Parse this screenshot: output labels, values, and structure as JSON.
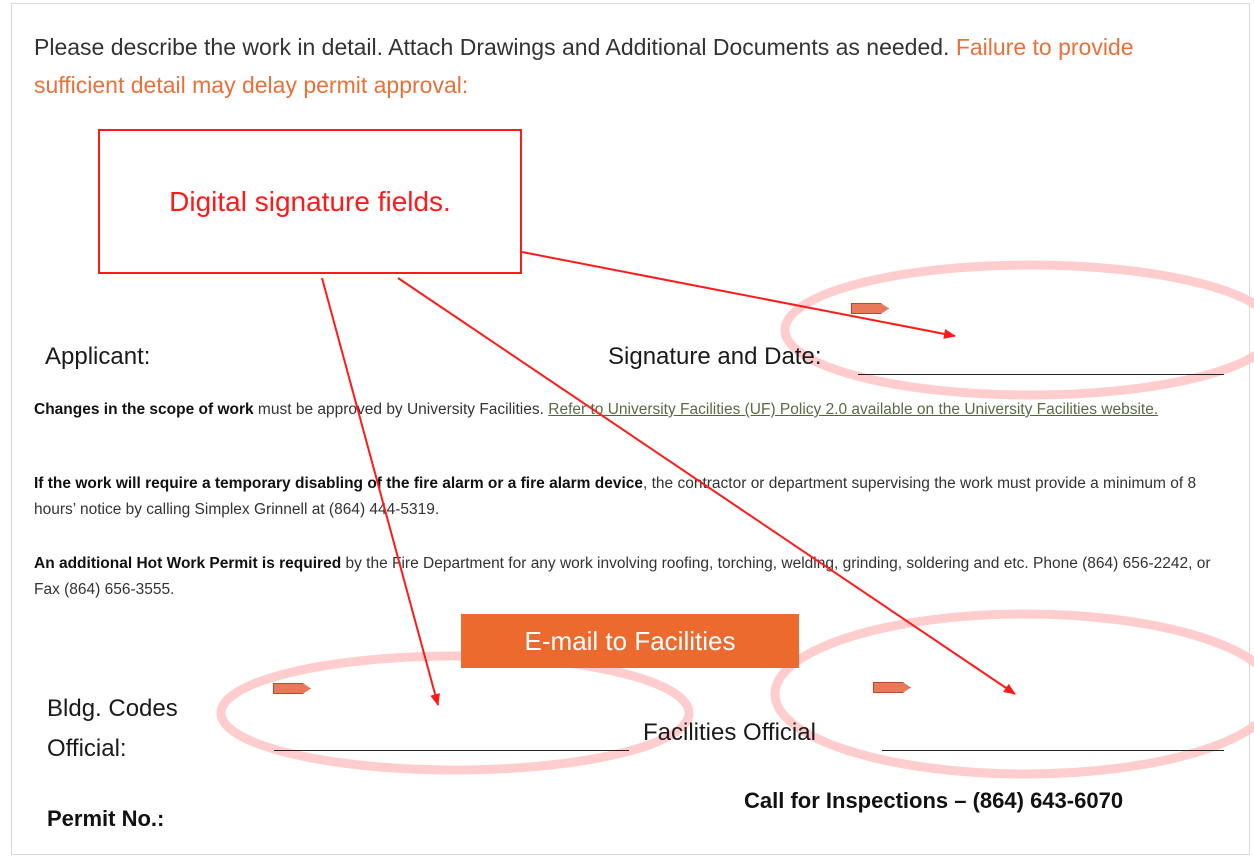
{
  "instructions": {
    "text": "Please describe the work in detail. Attach Drawings and Additional Documents as needed. ",
    "warning": "Failure to provide sufficient detail may delay permit approval:"
  },
  "callout": {
    "label": "Digital signature fields."
  },
  "applicant_row": {
    "applicant_label": "Applicant:",
    "signature_label": "Signature and Date:"
  },
  "notices": {
    "p1_bold": "Changes in the scope of work",
    "p1_text": " must be approved by University Facilities. ",
    "p1_link": "Refer to University Facilities (UF) Policy 2.0 available on the University Facilities website.",
    "p2_bold": "If the work will require a temporary disabling of the fire alarm or a fire alarm device",
    "p2_text": ", the contractor or department supervising the work must provide a minimum of 8 hours’ notice by calling Simplex Grinnell at (864) 444-5319.",
    "p3_bold": "An additional Hot Work Permit is required",
    "p3_text": " by the Fire Department for any work involving roofing, torching, welding, grinding, soldering and etc. Phone (864) 656-2242, or Fax (864) 656-3555."
  },
  "email_button": {
    "label": "E-mail to Facilities"
  },
  "officials": {
    "bldg_line1": "Bldg. Codes",
    "bldg_line2": "Official:",
    "facilities_label": "Facilities Official"
  },
  "footer": {
    "permit_label": "Permit No.:",
    "inspection_call": "Call for Inspections – (864) 643-6070"
  },
  "colors": {
    "accent_orange": "#ed6a2e",
    "callout_red": "#ff1a1a",
    "highlight_pink": "#ffc4c4"
  },
  "icons": {
    "signature_tag": "signature-flag-icon"
  }
}
